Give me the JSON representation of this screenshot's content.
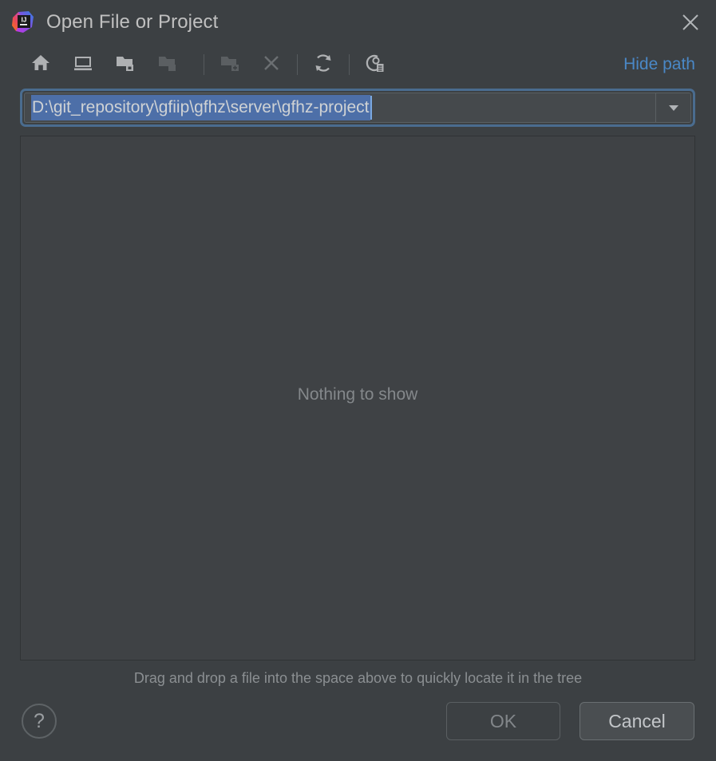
{
  "window": {
    "title": "Open File or Project",
    "logo_text": "IJ",
    "logo_name": "intellij-idea-logo",
    "close_icon": "close-icon"
  },
  "toolbar": {
    "buttons": [
      {
        "name": "home-icon",
        "tooltip": "Home",
        "enabled": true
      },
      {
        "name": "desktop-icon",
        "tooltip": "Desktop",
        "enabled": true
      },
      {
        "name": "folder-up-icon",
        "tooltip": "Up",
        "enabled": true
      },
      {
        "name": "folder-icon",
        "tooltip": "Project Folder",
        "enabled": false
      },
      {
        "name": "new-folder-icon",
        "tooltip": "New Folder",
        "enabled": false
      },
      {
        "name": "delete-icon",
        "tooltip": "Delete",
        "enabled": false
      },
      {
        "name": "refresh-icon",
        "tooltip": "Refresh",
        "enabled": true
      },
      {
        "name": "show-hidden-icon",
        "tooltip": "Show Hidden Files",
        "enabled": true
      }
    ],
    "hide_path_label": "Hide path"
  },
  "path_field": {
    "value": "D:\\git_repository\\gfiip\\gfhz\\server\\gfhz-project",
    "placeholder": "",
    "selected": true,
    "dropdown_icon": "chevron-down-icon"
  },
  "tree": {
    "empty_message": "Nothing to show"
  },
  "hint": {
    "text": "Drag and drop a file into the space above to quickly locate it in the tree"
  },
  "footer": {
    "help_label": "?",
    "ok_label": "OK",
    "ok_enabled": false,
    "cancel_label": "Cancel"
  },
  "colors": {
    "background": "#3c4043",
    "panel": "#3f4245",
    "link": "#4a88c7",
    "selection": "#4d6fa8",
    "focus_ring": "#4a6c8f",
    "text": "#bbbbbb",
    "text_dim": "#84888b",
    "icon_enabled": "#afb1b3",
    "icon_disabled": "#595d60"
  }
}
